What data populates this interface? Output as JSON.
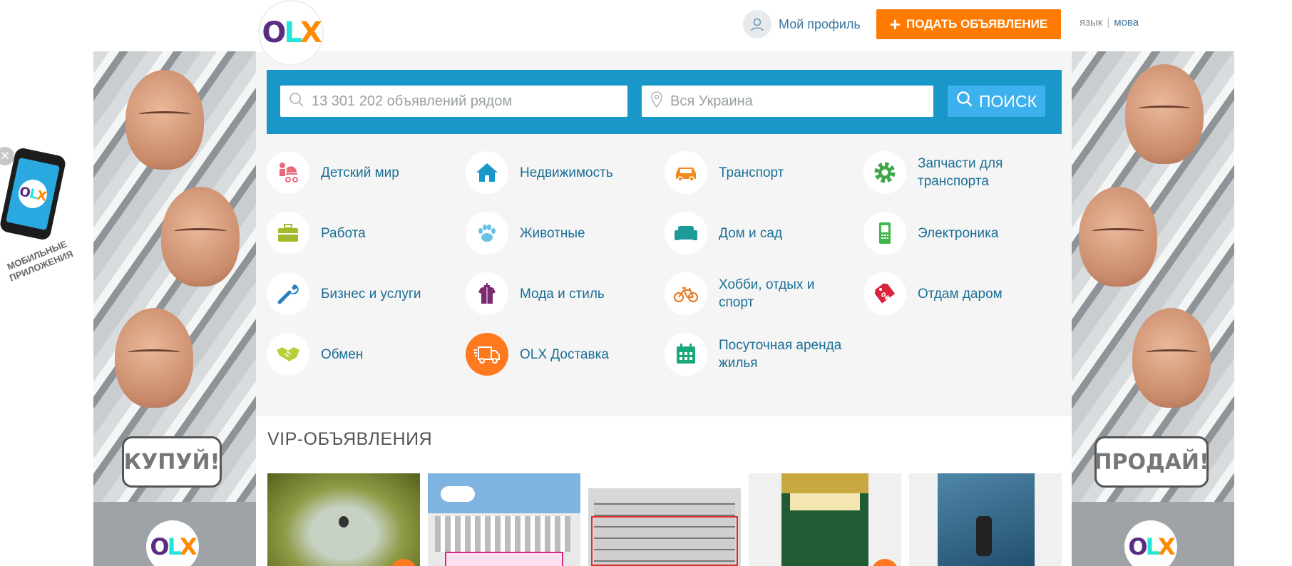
{
  "header": {
    "logo_text": [
      "O",
      "L",
      "X"
    ],
    "profile_label": "Мой профиль",
    "post_button_label": "ПОДАТЬ ОБЪЯВЛЕНИЕ",
    "lang_ru": "язык",
    "lang_sep": "|",
    "lang_ua": "мова"
  },
  "search": {
    "query_placeholder": "13 301 202 объявлений рядом",
    "location_placeholder": "Вся Украина",
    "button_label": "ПОИСК"
  },
  "categories": [
    {
      "label": "Детский мир",
      "icon": "stroller-icon",
      "color": "#e9697b"
    },
    {
      "label": "Недвижимость",
      "icon": "house-icon",
      "color": "#1a97c9"
    },
    {
      "label": "Транспорт",
      "icon": "car-icon",
      "color": "#f28c1e"
    },
    {
      "label": "Запчасти для транспорта",
      "icon": "gear-icon",
      "color": "#3fa64a"
    },
    {
      "label": "Работа",
      "icon": "briefcase-icon",
      "color": "#a6b92b"
    },
    {
      "label": "Животные",
      "icon": "paw-icon",
      "color": "#67c2e6"
    },
    {
      "label": "Дом и сад",
      "icon": "sofa-icon",
      "color": "#1f9a98"
    },
    {
      "label": "Электроника",
      "icon": "phone-icon",
      "color": "#3fb54b"
    },
    {
      "label": "Бизнес и услуги",
      "icon": "wrench-icon",
      "color": "#2a7fc1"
    },
    {
      "label": "Мода и стиль",
      "icon": "dress-icon",
      "color": "#7a2b6e"
    },
    {
      "label": "Хобби, отдых и спорт",
      "icon": "bicycle-icon",
      "color": "#e67d2e"
    },
    {
      "label": "Отдам даром",
      "icon": "price-tag-icon",
      "color": "#d8253b"
    },
    {
      "label": "Обмен",
      "icon": "handshake-icon",
      "color": "#b7cf3a"
    },
    {
      "label": "OLX Доставка",
      "icon": "truck-icon",
      "color": "#ff7a1f"
    },
    {
      "label": "Посуточная аренда жилья",
      "icon": "calendar-icon",
      "color": "#19a77d"
    }
  ],
  "vip": {
    "title": "VIP-ОБЪЯВЛЕНИЯ"
  },
  "banners": {
    "left_text": "КУПУЙ!",
    "right_text": "ПРОДАЙ!"
  },
  "app_promo": {
    "text": "МОБИЛЬНЫЕ ПРИЛОЖЕНИЯ"
  },
  "colors": {
    "brand_blue": "#1a97c9",
    "brand_orange": "#ff7a00",
    "link_blue": "#1b6f95"
  }
}
